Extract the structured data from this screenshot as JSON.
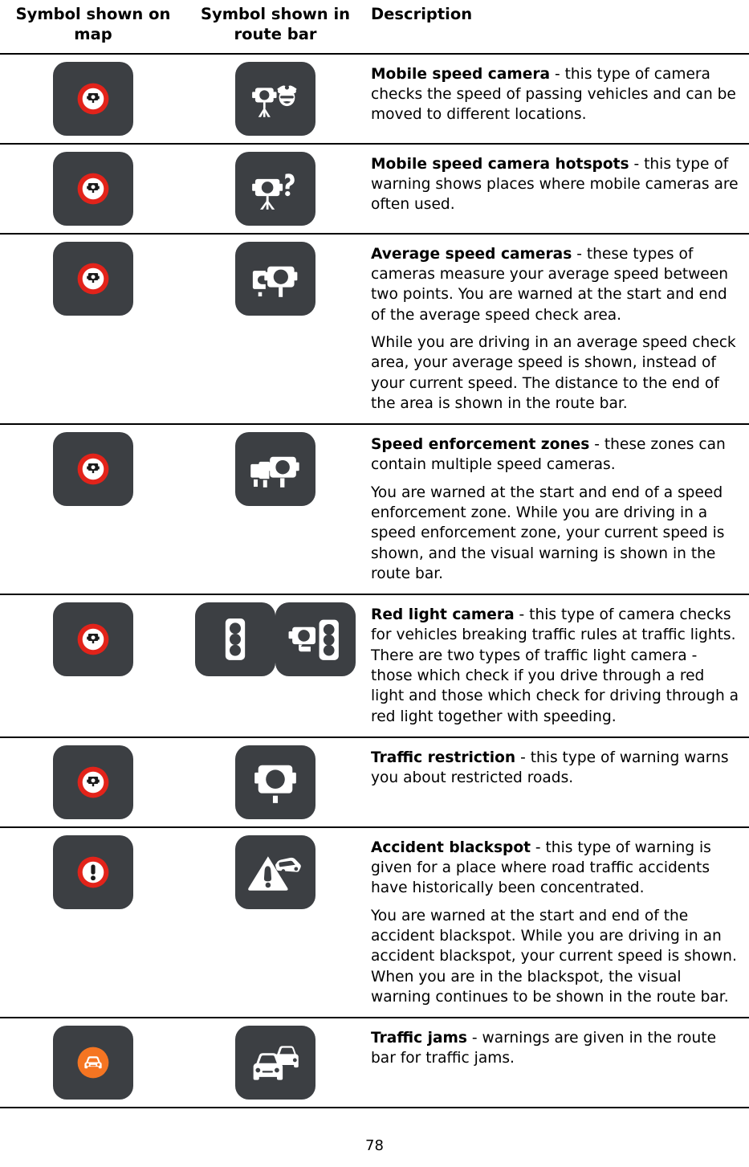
{
  "table": {
    "headers": {
      "map": "Symbol shown on map",
      "route_bar": "Symbol shown in route bar",
      "description": "Description"
    },
    "rows": [
      {
        "map_icon": "speed-camera-prohibition-sign-icon",
        "route_icons": [
          "mobile-speed-camera-police-icon"
        ],
        "term": "Mobile speed camera",
        "paragraphs": [
          " - this type of camera checks the speed of passing vehicles and can be moved to different locations."
        ]
      },
      {
        "map_icon": "speed-camera-prohibition-sign-icon",
        "route_icons": [
          "mobile-speed-camera-hotspot-question-icon"
        ],
        "term": "Mobile speed camera hotspots",
        "paragraphs": [
          " - this type of warning shows places where mobile cameras are often used."
        ]
      },
      {
        "map_icon": "speed-camera-prohibition-sign-icon",
        "route_icons": [
          "average-speed-camera-icon"
        ],
        "term": "Average speed cameras",
        "paragraphs": [
          " - these types of cameras measure your average speed between two points. You are warned at the start and end of the average speed check area.",
          "While you are driving in an average speed check area, your average speed is shown, instead of your current speed. The distance to the end of the area is shown in the route bar."
        ]
      },
      {
        "map_icon": "speed-camera-prohibition-sign-icon",
        "route_icons": [
          "speed-enforcement-zone-icon"
        ],
        "term": "Speed enforcement zones",
        "paragraphs": [
          " - these zones can contain multiple speed cameras.",
          "You are warned at the start and end of a speed enforcement zone. While you are driving in a speed enforcement zone, your current speed is shown, and the visual warning is shown in the route bar."
        ]
      },
      {
        "map_icon": "speed-camera-prohibition-sign-icon",
        "route_icons": [
          "traffic-light-icon",
          "red-light-camera-icon"
        ],
        "term": "Red light camera",
        "paragraphs": [
          " - this type of camera checks for vehicles breaking traffic rules at traffic lights. There are two types of traffic light camera - those which check if you drive through a red light and those which check for driving through a red light together with speeding."
        ]
      },
      {
        "map_icon": "speed-camera-prohibition-sign-icon",
        "route_icons": [
          "traffic-restriction-camera-icon"
        ],
        "term": "Traffic restriction",
        "paragraphs": [
          " - this type of warning warns you about restricted roads."
        ]
      },
      {
        "map_icon": "exclamation-prohibition-sign-icon",
        "route_icons": [
          "accident-blackspot-icon"
        ],
        "term": "Accident blackspot",
        "paragraphs": [
          " - this type of warning is given for a place where road traffic accidents have historically been concentrated.",
          "You are warned at the start and end of the accident blackspot. While you are driving in an accident blackspot, your current speed is shown. When you are in the blackspot, the visual warning continues to be shown in the route bar."
        ]
      },
      {
        "map_icon": "traffic-jam-car-orange-icon",
        "route_icons": [
          "traffic-jam-cars-icon"
        ],
        "term": "Traffic jams",
        "paragraphs": [
          " - warnings are given in the route bar for traffic jams."
        ]
      }
    ]
  },
  "footer": {
    "page_number": "78"
  },
  "colors": {
    "tile_background": "#3c3f43",
    "prohibition_red": "#e2231a",
    "traffic_orange": "#f57522",
    "icon_white": "#ffffff",
    "icon_black": "#1b1b1b",
    "rule_black": "#000000"
  }
}
